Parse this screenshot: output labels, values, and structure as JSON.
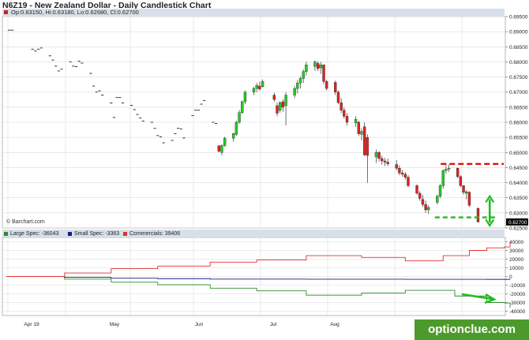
{
  "title": "N6Z19 - New Zealand Dollar - Daily Candlestick Chart",
  "ohlc_text": "Op:0.63150, Hi:0.63180, Lo:0.62680, Cl:0.62700",
  "credit": "© Barchart.com",
  "watermark": "optionclue.com",
  "colors": {
    "up": "#22cc22",
    "down": "#dd2222",
    "bar": "#333333",
    "large": "#2e8b2e",
    "small": "#1a1a8a",
    "commercials": "#dd3333",
    "annotation_red": "#dd1111",
    "annotation_green": "#22bb22",
    "price_flag": "#000000"
  },
  "cot_legend": [
    {
      "label": "Large Spec: -36043",
      "color": "#2e8b2e"
    },
    {
      "label": "Small Spec: -3363",
      "color": "#1a1a8a"
    },
    {
      "label": "Commercials: 39406",
      "color": "#dd3333"
    }
  ],
  "chart_data": [
    {
      "type": "candlestick",
      "title": "N6Z19 - New Zealand Dollar - Daily Candlestick Chart",
      "x_ticks": [
        "Apr 19",
        "May",
        "Jun",
        "Jul",
        "Aug"
      ],
      "y_ticks": [
        "0.69500",
        "0.69000",
        "0.68500",
        "0.68000",
        "0.67500",
        "0.67000",
        "0.66500",
        "0.66000",
        "0.65500",
        "0.65000",
        "0.64500",
        "0.64000",
        "0.63500",
        "0.63000",
        "0.62500"
      ],
      "ylim": [
        0.625,
        0.695
      ],
      "last_price": "0.62700",
      "annotations": {
        "resistance": 0.6462,
        "support": 0.6285
      },
      "bars": [
        {
          "day": 1,
          "o": 0.6905,
          "h": 0.6907,
          "l": 0.6903,
          "c": 0.6905
        },
        {
          "day": 2,
          "o": 0.6905,
          "h": 0.6907,
          "l": 0.6903,
          "c": 0.6905
        },
        {
          "day": 9,
          "o": 0.6842,
          "h": 0.6844,
          "l": 0.684,
          "c": 0.6842
        },
        {
          "day": 10,
          "o": 0.6836,
          "h": 0.6838,
          "l": 0.6834,
          "c": 0.6836
        },
        {
          "day": 11,
          "o": 0.6842,
          "h": 0.6844,
          "l": 0.684,
          "c": 0.6842
        },
        {
          "day": 12,
          "o": 0.6846,
          "h": 0.6848,
          "l": 0.6844,
          "c": 0.6846
        },
        {
          "day": 15,
          "o": 0.682,
          "h": 0.6822,
          "l": 0.6818,
          "c": 0.682
        },
        {
          "day": 16,
          "o": 0.6806,
          "h": 0.6808,
          "l": 0.6804,
          "c": 0.6806
        },
        {
          "day": 17,
          "o": 0.6786,
          "h": 0.6788,
          "l": 0.6784,
          "c": 0.6786
        },
        {
          "day": 18,
          "o": 0.677,
          "h": 0.6772,
          "l": 0.6768,
          "c": 0.677
        },
        {
          "day": 19,
          "o": 0.6776,
          "h": 0.6778,
          "l": 0.6774,
          "c": 0.6776
        },
        {
          "day": 22,
          "o": 0.68,
          "h": 0.6802,
          "l": 0.6798,
          "c": 0.68
        },
        {
          "day": 23,
          "o": 0.6786,
          "h": 0.6788,
          "l": 0.6784,
          "c": 0.6786
        },
        {
          "day": 24,
          "o": 0.6784,
          "h": 0.6786,
          "l": 0.6782,
          "c": 0.6784
        },
        {
          "day": 25,
          "o": 0.6802,
          "h": 0.6804,
          "l": 0.68,
          "c": 0.6802
        },
        {
          "day": 26,
          "o": 0.6796,
          "h": 0.6798,
          "l": 0.6794,
          "c": 0.6796
        },
        {
          "day": 29,
          "o": 0.6762,
          "h": 0.6764,
          "l": 0.676,
          "c": 0.6762
        },
        {
          "day": 30,
          "o": 0.672,
          "h": 0.6722,
          "l": 0.6718,
          "c": 0.672
        },
        {
          "day": 31,
          "o": 0.67,
          "h": 0.6702,
          "l": 0.6698,
          "c": 0.67
        },
        {
          "day": 32,
          "o": 0.6704,
          "h": 0.6706,
          "l": 0.6702,
          "c": 0.6704
        },
        {
          "day": 33,
          "o": 0.669,
          "h": 0.6692,
          "l": 0.6688,
          "c": 0.669
        },
        {
          "day": 36,
          "o": 0.6664,
          "h": 0.6666,
          "l": 0.6662,
          "c": 0.6664
        },
        {
          "day": 37,
          "o": 0.6616,
          "h": 0.6618,
          "l": 0.6614,
          "c": 0.6616
        },
        {
          "day": 38,
          "o": 0.6682,
          "h": 0.6684,
          "l": 0.668,
          "c": 0.6682
        },
        {
          "day": 39,
          "o": 0.6682,
          "h": 0.6684,
          "l": 0.668,
          "c": 0.6682
        },
        {
          "day": 40,
          "o": 0.6664,
          "h": 0.6666,
          "l": 0.6662,
          "c": 0.6664
        },
        {
          "day": 43,
          "o": 0.6656,
          "h": 0.6658,
          "l": 0.6654,
          "c": 0.6656
        },
        {
          "day": 44,
          "o": 0.6642,
          "h": 0.6644,
          "l": 0.664,
          "c": 0.6642
        },
        {
          "day": 45,
          "o": 0.6626,
          "h": 0.6628,
          "l": 0.6624,
          "c": 0.6626
        },
        {
          "day": 46,
          "o": 0.6614,
          "h": 0.6616,
          "l": 0.6612,
          "c": 0.6614
        },
        {
          "day": 47,
          "o": 0.6604,
          "h": 0.6606,
          "l": 0.6602,
          "c": 0.6604
        },
        {
          "day": 50,
          "o": 0.66,
          "h": 0.6602,
          "l": 0.6598,
          "c": 0.66
        },
        {
          "day": 51,
          "o": 0.658,
          "h": 0.6582,
          "l": 0.6578,
          "c": 0.658
        },
        {
          "day": 52,
          "o": 0.6556,
          "h": 0.6558,
          "l": 0.6554,
          "c": 0.6556
        },
        {
          "day": 53,
          "o": 0.6552,
          "h": 0.6554,
          "l": 0.655,
          "c": 0.6552
        },
        {
          "day": 54,
          "o": 0.6532,
          "h": 0.6534,
          "l": 0.653,
          "c": 0.6532
        },
        {
          "day": 57,
          "o": 0.654,
          "h": 0.6542,
          "l": 0.6538,
          "c": 0.654
        },
        {
          "day": 58,
          "o": 0.6562,
          "h": 0.6564,
          "l": 0.656,
          "c": 0.6562
        },
        {
          "day": 59,
          "o": 0.658,
          "h": 0.6582,
          "l": 0.6578,
          "c": 0.658
        },
        {
          "day": 60,
          "o": 0.6578,
          "h": 0.658,
          "l": 0.6576,
          "c": 0.6578
        },
        {
          "day": 61,
          "o": 0.6548,
          "h": 0.655,
          "l": 0.6546,
          "c": 0.6548
        },
        {
          "day": 64,
          "o": 0.6622,
          "h": 0.6624,
          "l": 0.662,
          "c": 0.6622
        },
        {
          "day": 65,
          "o": 0.664,
          "h": 0.6642,
          "l": 0.6638,
          "c": 0.664
        },
        {
          "day": 66,
          "o": 0.664,
          "h": 0.6642,
          "l": 0.6638,
          "c": 0.664
        },
        {
          "day": 67,
          "o": 0.666,
          "h": 0.6662,
          "l": 0.6658,
          "c": 0.666
        },
        {
          "day": 68,
          "o": 0.6672,
          "h": 0.6674,
          "l": 0.667,
          "c": 0.6672
        },
        {
          "day": 71,
          "o": 0.66,
          "h": 0.6602,
          "l": 0.6598,
          "c": 0.66
        },
        {
          "day": 72,
          "o": 0.6596,
          "h": 0.6598,
          "l": 0.6594,
          "c": 0.6596
        },
        {
          "day": 73,
          "o": 0.6522,
          "h": 0.6524,
          "l": 0.65,
          "c": 0.6504
        },
        {
          "day": 74,
          "o": 0.65,
          "h": 0.6527,
          "l": 0.6491,
          "c": 0.6523
        },
        {
          "day": 75,
          "o": 0.6523,
          "h": 0.6552,
          "l": 0.6519,
          "c": 0.6547
        },
        {
          "day": 78,
          "o": 0.6547,
          "h": 0.6565,
          "l": 0.6536,
          "c": 0.6563
        },
        {
          "day": 79,
          "o": 0.656,
          "h": 0.6605,
          "l": 0.6555,
          "c": 0.66
        },
        {
          "day": 80,
          "o": 0.66,
          "h": 0.664,
          "l": 0.6595,
          "c": 0.6632
        },
        {
          "day": 81,
          "o": 0.6632,
          "h": 0.6672,
          "l": 0.6628,
          "c": 0.6668
        },
        {
          "day": 82,
          "o": 0.6668,
          "h": 0.6705,
          "l": 0.666,
          "c": 0.67
        },
        {
          "day": 85,
          "o": 0.67,
          "h": 0.6718,
          "l": 0.669,
          "c": 0.6712
        },
        {
          "day": 86,
          "o": 0.6712,
          "h": 0.673,
          "l": 0.67,
          "c": 0.6722
        },
        {
          "day": 87,
          "o": 0.672,
          "h": 0.6735,
          "l": 0.6705,
          "c": 0.671
        },
        {
          "day": 88,
          "o": 0.6718,
          "h": 0.6742,
          "l": 0.6715,
          "c": 0.6735
        },
        {
          "day": 92,
          "o": 0.669,
          "h": 0.6698,
          "l": 0.6668,
          "c": 0.6675
        },
        {
          "day": 93,
          "o": 0.6655,
          "h": 0.6665,
          "l": 0.662,
          "c": 0.663
        },
        {
          "day": 94,
          "o": 0.664,
          "h": 0.667,
          "l": 0.6632,
          "c": 0.6665
        },
        {
          "day": 95,
          "o": 0.6668,
          "h": 0.6676,
          "l": 0.6635,
          "c": 0.665
        },
        {
          "day": 96,
          "o": 0.6655,
          "h": 0.67,
          "l": 0.659,
          "c": 0.669
        },
        {
          "day": 99,
          "o": 0.669,
          "h": 0.672,
          "l": 0.668,
          "c": 0.6712
        },
        {
          "day": 100,
          "o": 0.6712,
          "h": 0.674,
          "l": 0.6695,
          "c": 0.673
        },
        {
          "day": 101,
          "o": 0.673,
          "h": 0.6752,
          "l": 0.6712,
          "c": 0.6745
        },
        {
          "day": 102,
          "o": 0.6745,
          "h": 0.6775,
          "l": 0.673,
          "c": 0.6768
        },
        {
          "day": 103,
          "o": 0.6768,
          "h": 0.68,
          "l": 0.6755,
          "c": 0.679
        },
        {
          "day": 106,
          "o": 0.6785,
          "h": 0.6805,
          "l": 0.677,
          "c": 0.68
        },
        {
          "day": 107,
          "o": 0.6795,
          "h": 0.6802,
          "l": 0.677,
          "c": 0.6778
        },
        {
          "day": 108,
          "o": 0.678,
          "h": 0.68,
          "l": 0.676,
          "c": 0.679
        },
        {
          "day": 109,
          "o": 0.679,
          "h": 0.6792,
          "l": 0.6725,
          "c": 0.6735
        },
        {
          "day": 110,
          "o": 0.6735,
          "h": 0.674,
          "l": 0.6705,
          "c": 0.6712
        },
        {
          "day": 113,
          "o": 0.6732,
          "h": 0.6738,
          "l": 0.669,
          "c": 0.67
        },
        {
          "day": 114,
          "o": 0.67,
          "h": 0.6705,
          "l": 0.666,
          "c": 0.6665
        },
        {
          "day": 115,
          "o": 0.6665,
          "h": 0.668,
          "l": 0.663,
          "c": 0.664
        },
        {
          "day": 116,
          "o": 0.664,
          "h": 0.665,
          "l": 0.6612,
          "c": 0.662
        },
        {
          "day": 117,
          "o": 0.662,
          "h": 0.663,
          "l": 0.659,
          "c": 0.66
        },
        {
          "day": 120,
          "o": 0.6598,
          "h": 0.662,
          "l": 0.6585,
          "c": 0.661
        },
        {
          "day": 121,
          "o": 0.66,
          "h": 0.6605,
          "l": 0.6555,
          "c": 0.6562
        },
        {
          "day": 122,
          "o": 0.656,
          "h": 0.658,
          "l": 0.654,
          "c": 0.657
        },
        {
          "day": 123,
          "o": 0.6585,
          "h": 0.66,
          "l": 0.6488,
          "c": 0.6492
        },
        {
          "day": 124,
          "o": 0.655,
          "h": 0.656,
          "l": 0.64,
          "c": 0.649
        },
        {
          "day": 127,
          "o": 0.6485,
          "h": 0.651,
          "l": 0.6465,
          "c": 0.65
        },
        {
          "day": 128,
          "o": 0.65,
          "h": 0.6505,
          "l": 0.647,
          "c": 0.648
        },
        {
          "day": 129,
          "o": 0.648,
          "h": 0.649,
          "l": 0.646,
          "c": 0.6472
        },
        {
          "day": 130,
          "o": 0.6472,
          "h": 0.6482,
          "l": 0.6455,
          "c": 0.6468
        },
        {
          "day": 131,
          "o": 0.6468,
          "h": 0.648,
          "l": 0.6455,
          "c": 0.6462
        },
        {
          "day": 134,
          "o": 0.646,
          "h": 0.6475,
          "l": 0.644,
          "c": 0.6448
        },
        {
          "day": 135,
          "o": 0.6448,
          "h": 0.6458,
          "l": 0.6425,
          "c": 0.6432
        },
        {
          "day": 136,
          "o": 0.6432,
          "h": 0.6442,
          "l": 0.642,
          "c": 0.6428
        },
        {
          "day": 137,
          "o": 0.6428,
          "h": 0.6435,
          "l": 0.641,
          "c": 0.6418
        },
        {
          "day": 138,
          "o": 0.6418,
          "h": 0.6425,
          "l": 0.6385,
          "c": 0.639
        },
        {
          "day": 141,
          "o": 0.639,
          "h": 0.6395,
          "l": 0.636,
          "c": 0.6365
        },
        {
          "day": 142,
          "o": 0.6365,
          "h": 0.6372,
          "l": 0.634,
          "c": 0.6348
        },
        {
          "day": 143,
          "o": 0.6345,
          "h": 0.636,
          "l": 0.632,
          "c": 0.6328
        },
        {
          "day": 144,
          "o": 0.6328,
          "h": 0.634,
          "l": 0.63,
          "c": 0.631
        },
        {
          "day": 145,
          "o": 0.631,
          "h": 0.6325,
          "l": 0.6296,
          "c": 0.6318
        },
        {
          "day": 148,
          "o": 0.6335,
          "h": 0.636,
          "l": 0.6328,
          "c": 0.6355
        },
        {
          "day": 149,
          "o": 0.6355,
          "h": 0.6395,
          "l": 0.6348,
          "c": 0.639
        },
        {
          "day": 150,
          "o": 0.639,
          "h": 0.6445,
          "l": 0.638,
          "c": 0.644
        },
        {
          "day": 151,
          "o": 0.644,
          "h": 0.6465,
          "l": 0.643,
          "c": 0.6445
        },
        {
          "day": 152,
          "o": 0.6445,
          "h": 0.646,
          "l": 0.6435,
          "c": 0.6448
        },
        {
          "day": 155,
          "o": 0.6448,
          "h": 0.645,
          "l": 0.6415,
          "c": 0.642
        },
        {
          "day": 156,
          "o": 0.642,
          "h": 0.6425,
          "l": 0.6385,
          "c": 0.639
        },
        {
          "day": 157,
          "o": 0.639,
          "h": 0.6392,
          "l": 0.636,
          "c": 0.6368
        },
        {
          "day": 158,
          "o": 0.6365,
          "h": 0.6375,
          "l": 0.6345,
          "c": 0.637
        },
        {
          "day": 159,
          "o": 0.6368,
          "h": 0.6372,
          "l": 0.632,
          "c": 0.6325
        },
        {
          "day": 162,
          "o": 0.6315,
          "h": 0.6318,
          "l": 0.6268,
          "c": 0.627
        }
      ]
    },
    {
      "type": "line",
      "title": "",
      "y_ticks": [
        "40000",
        "30000",
        "20000",
        "10000",
        "0",
        "-10000",
        "-20000",
        "-30000",
        "-40000"
      ],
      "ylim": [
        -45000,
        45000
      ],
      "legend": "top-left",
      "series": [
        {
          "name": "Large Spec: -36043",
          "points": [
            [
              0,
              0
            ],
            [
              20,
              -3000
            ],
            [
              36,
              -6500
            ],
            [
              52,
              -9500
            ],
            [
              70,
              -13500
            ],
            [
              86,
              -16500
            ],
            [
              103,
              -21500
            ],
            [
              122,
              -19000
            ],
            [
              137,
              -16000
            ],
            [
              154,
              -22500
            ],
            [
              165,
              -30000
            ],
            [
              171,
              -30500
            ],
            [
              173,
              -36043
            ]
          ]
        },
        {
          "name": "Small Spec: -3363",
          "points": [
            [
              0,
              0
            ],
            [
              20,
              -1000
            ],
            [
              36,
              -2000
            ],
            [
              52,
              -2500
            ],
            [
              70,
              -3000
            ],
            [
              103,
              -3100
            ],
            [
              137,
              -3200
            ],
            [
              165,
              -3300
            ],
            [
              173,
              -3363
            ]
          ]
        },
        {
          "name": "Commercials: 39406",
          "points": [
            [
              0,
              0
            ],
            [
              20,
              4000
            ],
            [
              36,
              9000
            ],
            [
              52,
              12000
            ],
            [
              70,
              16500
            ],
            [
              86,
              19000
            ],
            [
              103,
              24000
            ],
            [
              122,
              22000
            ],
            [
              137,
              18000
            ],
            [
              150,
              24000
            ],
            [
              159,
              30000
            ],
            [
              165,
              33000
            ],
            [
              171,
              34000
            ],
            [
              173,
              39406
            ]
          ]
        }
      ]
    }
  ]
}
